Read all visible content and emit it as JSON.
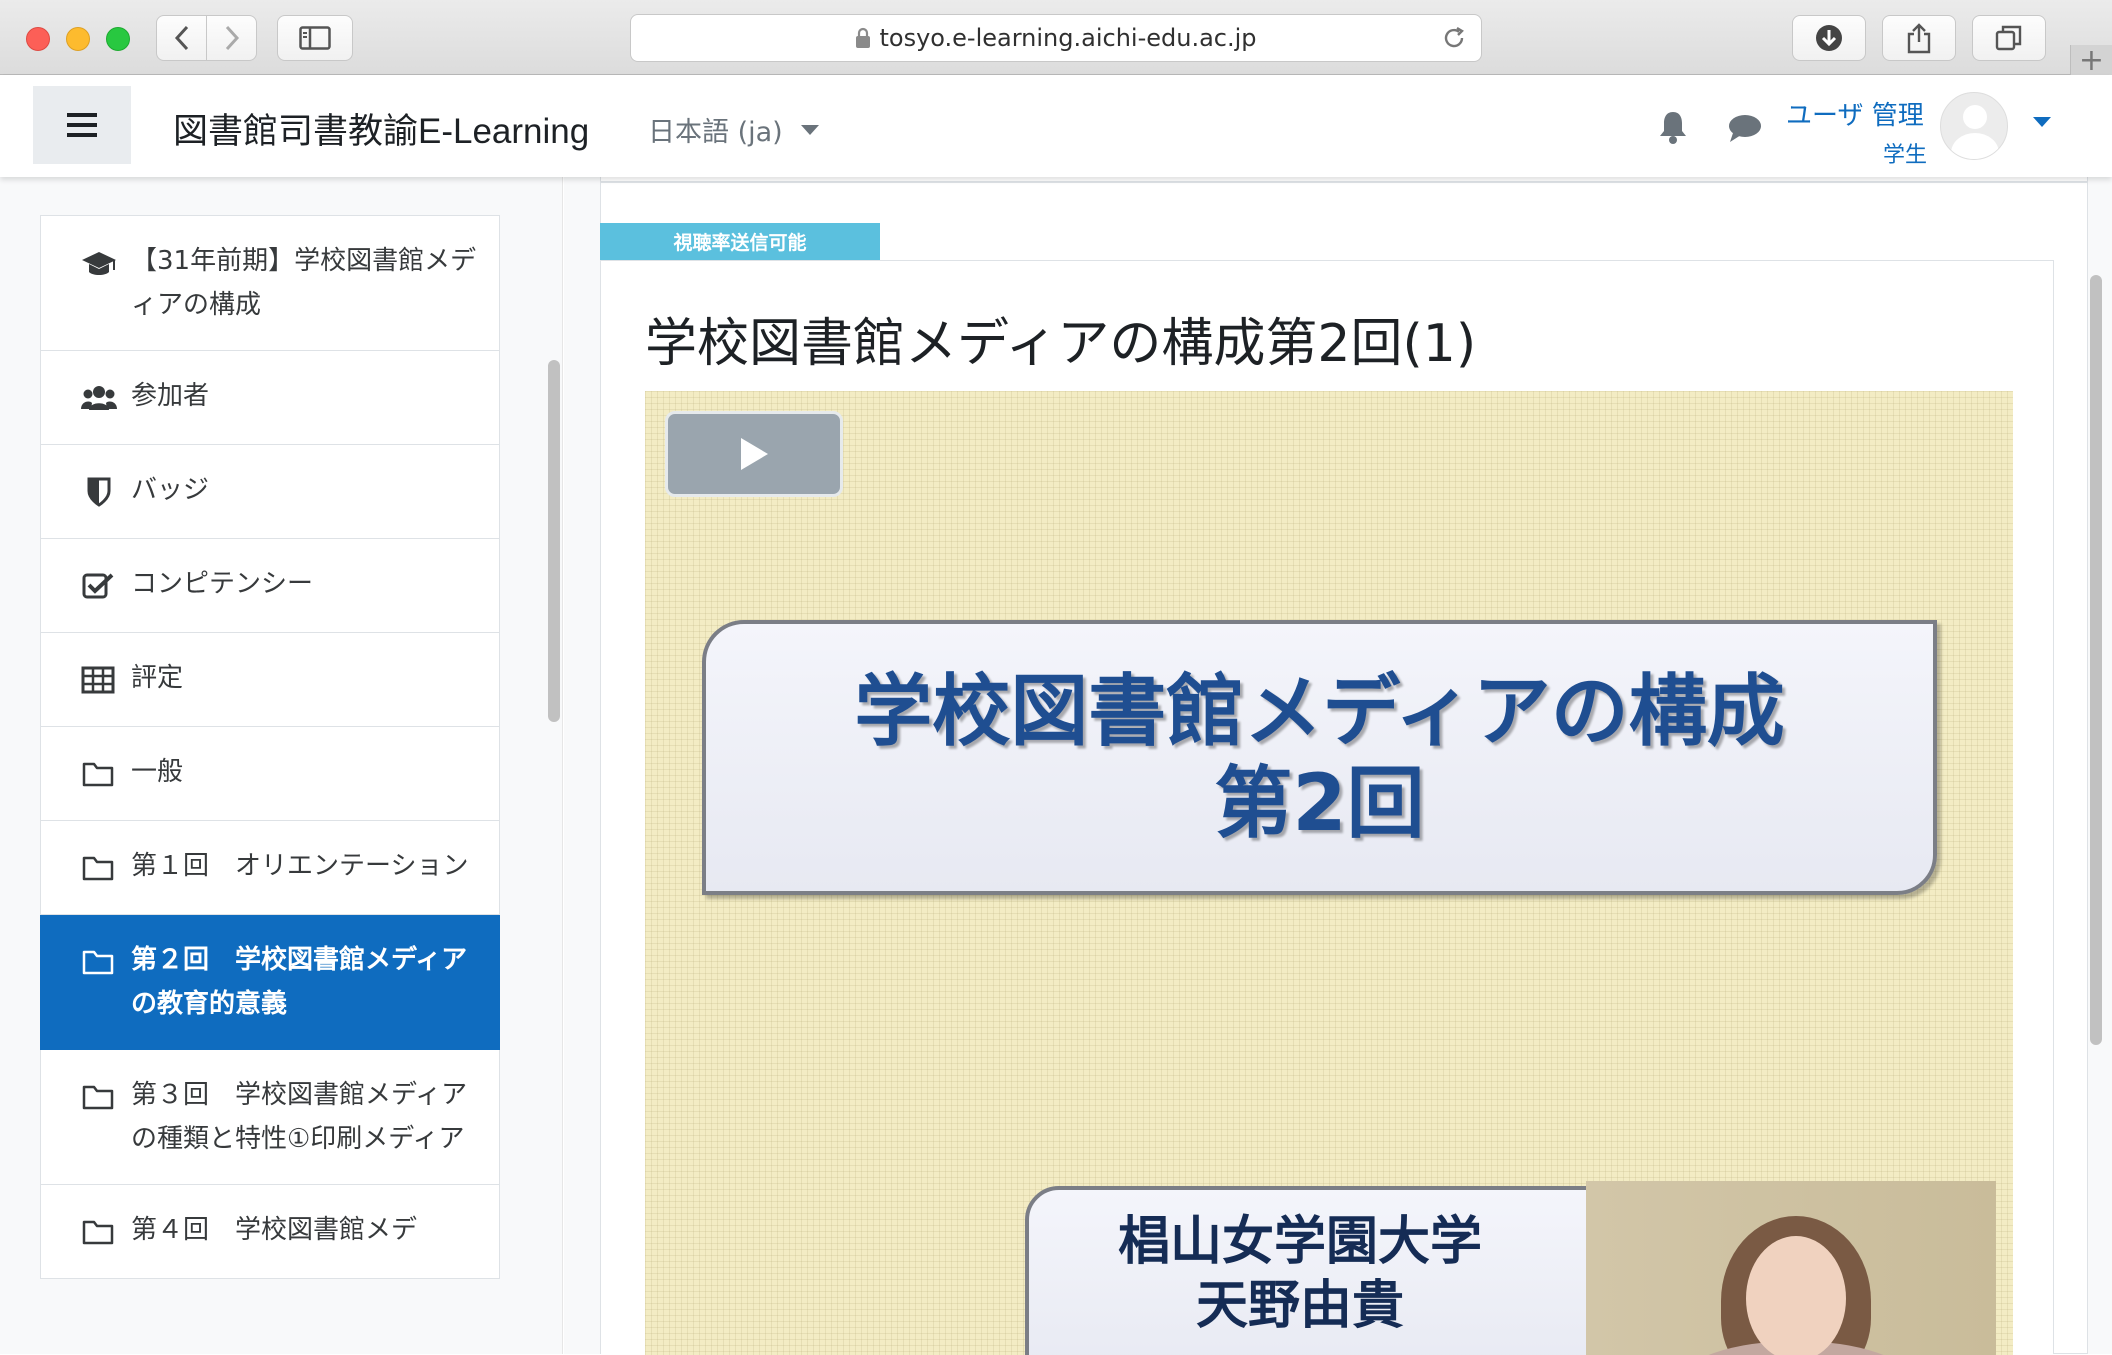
{
  "browser": {
    "url": "tosyo.e-learning.aichi-edu.ac.jp"
  },
  "navbar": {
    "site_name": "図書館司書教諭E-Learning",
    "language": "日本語 (ja)",
    "user_name": "ユーザ 管理",
    "user_role": "学生"
  },
  "drawer": {
    "items": [
      {
        "label": "【31年前期】学校図書館メディアの構成",
        "icon": "graduation-cap-icon"
      },
      {
        "label": "参加者",
        "icon": "users-icon"
      },
      {
        "label": "バッジ",
        "icon": "shield-icon"
      },
      {
        "label": "コンピテンシー",
        "icon": "checkbox-icon"
      },
      {
        "label": "評定",
        "icon": "table-icon"
      },
      {
        "label": "一般",
        "icon": "folder-icon"
      },
      {
        "label": "第１回　オリエンテーション",
        "icon": "folder-icon"
      },
      {
        "label": "第２回　学校図書館メディアの教育的意義",
        "icon": "folder-icon",
        "active": true
      },
      {
        "label": "第３回　学校図書館メディアの種類と特性①印刷メディア",
        "icon": "folder-icon"
      },
      {
        "label": "第４回　学校図書館メデ",
        "icon": "folder-icon"
      }
    ]
  },
  "main": {
    "badge": "視聴率送信可能",
    "title": "学校図書館メディアの構成第2回(1)",
    "video": {
      "slide_title_line1": "学校図書館メディアの構成",
      "slide_title_line2": "第2回",
      "presenter_line1": "椙山女学園大学",
      "presenter_line2": "天野由貴"
    }
  },
  "colors": {
    "accent": "#0f6cbf",
    "badge": "#5bc0de"
  }
}
